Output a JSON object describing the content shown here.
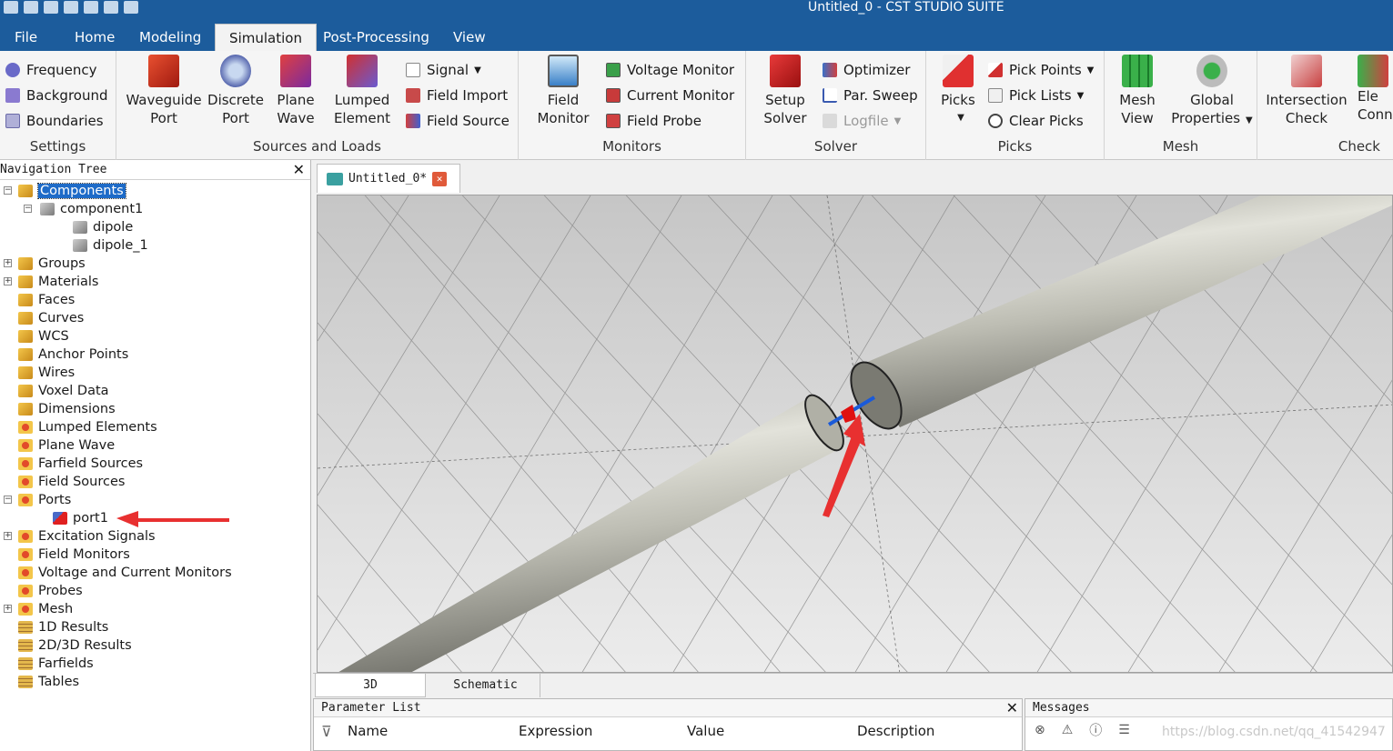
{
  "window": {
    "title": "Untitled_0 - CST STUDIO SUITE"
  },
  "menu_tabs": [
    "File",
    "Home",
    "Modeling",
    "Simulation",
    "Post-Processing",
    "View"
  ],
  "active_tab": "Simulation",
  "ribbon": {
    "settings": {
      "label": "Settings",
      "items": [
        "Frequency",
        "Background",
        "Boundaries"
      ]
    },
    "sources": {
      "label": "Sources and Loads",
      "big": [
        [
          "Waveguide",
          "Port"
        ],
        [
          "Discrete",
          "Port"
        ],
        [
          "Plane",
          "Wave"
        ],
        [
          "Lumped",
          "Element"
        ]
      ],
      "small": [
        "Signal",
        "Field Import",
        "Field Source"
      ]
    },
    "monitors": {
      "label": "Monitors",
      "big": [
        [
          "Field",
          "Monitor"
        ]
      ],
      "small": [
        "Voltage Monitor",
        "Current Monitor",
        "Field Probe"
      ]
    },
    "solver": {
      "label": "Solver",
      "big": [
        [
          "Setup",
          "Solver"
        ]
      ],
      "small": [
        "Optimizer",
        "Par. Sweep",
        "Logfile"
      ]
    },
    "picks": {
      "label": "Picks",
      "big": [
        [
          "Picks",
          ""
        ]
      ],
      "small": [
        "Pick Points",
        "Pick Lists",
        "Clear Picks"
      ]
    },
    "mesh": {
      "label": "Mesh",
      "big": [
        [
          "Mesh",
          "View"
        ],
        [
          "Global",
          "Properties"
        ]
      ]
    },
    "check": {
      "label": "Check",
      "big": [
        [
          "Intersection",
          "Check"
        ],
        [
          "Ele",
          "Conn"
        ]
      ]
    }
  },
  "nav": {
    "title": "Navigation Tree",
    "close": "✕",
    "items": [
      {
        "label": "Components",
        "icon": "y",
        "selected": true
      },
      {
        "label": "component1",
        "icon": "box"
      },
      {
        "label": "dipole",
        "icon": "box"
      },
      {
        "label": "dipole_1",
        "icon": "box"
      },
      {
        "label": "Groups",
        "icon": "y"
      },
      {
        "label": "Materials",
        "icon": "y"
      },
      {
        "label": "Faces",
        "icon": "y"
      },
      {
        "label": "Curves",
        "icon": "y"
      },
      {
        "label": "WCS",
        "icon": "y"
      },
      {
        "label": "Anchor Points",
        "icon": "y"
      },
      {
        "label": "Wires",
        "icon": "y"
      },
      {
        "label": "Voxel Data",
        "icon": "y"
      },
      {
        "label": "Dimensions",
        "icon": "y"
      },
      {
        "label": "Lumped Elements",
        "icon": "r"
      },
      {
        "label": "Plane Wave",
        "icon": "r"
      },
      {
        "label": "Farfield Sources",
        "icon": "r"
      },
      {
        "label": "Field Sources",
        "icon": "r"
      },
      {
        "label": "Ports",
        "icon": "r"
      },
      {
        "label": "port1",
        "icon": "port"
      },
      {
        "label": "Excitation Signals",
        "icon": "r"
      },
      {
        "label": "Field Monitors",
        "icon": "r"
      },
      {
        "label": "Voltage and Current Monitors",
        "icon": "r"
      },
      {
        "label": "Probes",
        "icon": "r"
      },
      {
        "label": "Mesh",
        "icon": "r"
      },
      {
        "label": "1D Results",
        "icon": "s"
      },
      {
        "label": "2D/3D Results",
        "icon": "s"
      },
      {
        "label": "Farfields",
        "icon": "s"
      },
      {
        "label": "Tables",
        "icon": "s"
      }
    ]
  },
  "document": {
    "tab_label": "Untitled_0*"
  },
  "view_tabs": [
    "3D",
    "Schematic"
  ],
  "params": {
    "title": "Parameter List",
    "columns": [
      "Name",
      "Expression",
      "Value",
      "Description"
    ]
  },
  "messages": {
    "title": "Messages",
    "watermark": "https://blog.csdn.net/qq_41542947"
  }
}
